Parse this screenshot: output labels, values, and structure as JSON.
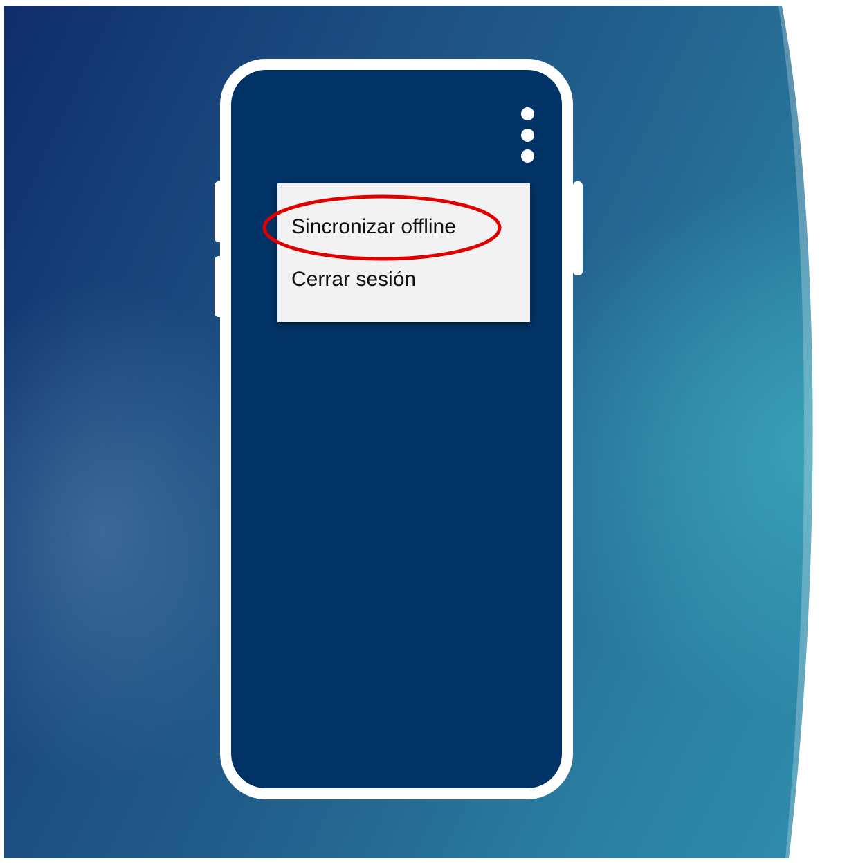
{
  "menu": {
    "items": [
      {
        "label": "Sincronizar offline",
        "highlighted": true
      },
      {
        "label": "Cerrar sesión",
        "highlighted": false
      }
    ]
  },
  "icons": {
    "overflow": "more-vert-icon"
  },
  "colors": {
    "phone_screen": "#023366",
    "phone_frame": "#ffffff",
    "menu_background": "#f2f2f2",
    "highlight_ring": "#e00000"
  }
}
